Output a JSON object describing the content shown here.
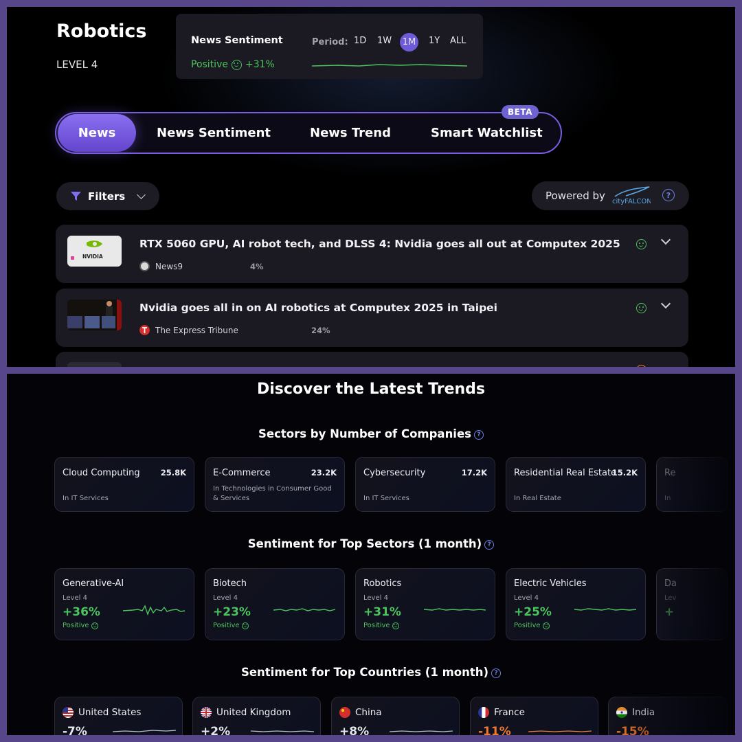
{
  "header": {
    "title": "Robotics",
    "level": "LEVEL 4"
  },
  "sentiment_card": {
    "title": "News Sentiment",
    "status": "Positive",
    "change": "+31%",
    "period_label": "Period:",
    "periods": [
      "1D",
      "1W",
      "1M",
      "1Y",
      "ALL"
    ],
    "active_period": "1M"
  },
  "tabs": [
    "News",
    "News Sentiment",
    "News Trend",
    "Smart Watchlist"
  ],
  "beta_badge": "BETA",
  "filters": {
    "label": "Filters"
  },
  "powered": {
    "label": "Powered by",
    "logo_text": "cityFALCON",
    "help": "?"
  },
  "news": [
    {
      "title": "RTX 5060 GPU, AI robot tech, and DLSS 4: Nvidia goes all out at Computex 2025",
      "source": "News9",
      "percent": "4%",
      "thumb_text": "NVIDIA"
    },
    {
      "title": "Nvidia goes all in on AI robotics at Computex 2025 in Taipei",
      "source": "The Express Tribune",
      "percent": "24%"
    }
  ],
  "bottom": {
    "title": "Discover the Latest Trends",
    "sectors_heading": "Sectors by Number of Companies",
    "sentiment_heading": "Sentiment for Top Sectors (1 month)",
    "countries_heading": "Sentiment for Top Countries (1 month)",
    "help": "?"
  },
  "sectors_by_companies": [
    {
      "name": "Cloud Computing",
      "count": "25.8K",
      "sub": "In IT Services"
    },
    {
      "name": "E-Commerce",
      "count": "23.2K",
      "sub": "In Technologies in Consumer Good & Services"
    },
    {
      "name": "Cybersecurity",
      "count": "17.2K",
      "sub": "In IT Services"
    },
    {
      "name": "Residential Real Estate",
      "count": "15.2K",
      "sub": "In Real Estate"
    },
    {
      "name": "Re",
      "count": "",
      "sub": "In"
    }
  ],
  "sector_sentiment": [
    {
      "name": "Generative-AI",
      "level": "Level 4",
      "value": "+36%",
      "status": "Positive"
    },
    {
      "name": "Biotech",
      "level": "Level 4",
      "value": "+23%",
      "status": "Positive"
    },
    {
      "name": "Robotics",
      "level": "Level 4",
      "value": "+31%",
      "status": "Positive"
    },
    {
      "name": "Electric Vehicles",
      "level": "Level 4",
      "value": "+25%",
      "status": "Positive"
    },
    {
      "name": "Da",
      "level": "Lev",
      "value": "+",
      "status": ""
    }
  ],
  "countries": [
    {
      "name": "United States",
      "value": "-7%",
      "flag": "us-flag-icon",
      "color": "#e6e6ee"
    },
    {
      "name": "United Kingdom",
      "value": "+2%",
      "flag": "uk-flag-icon",
      "color": "#e6e6ee"
    },
    {
      "name": "China",
      "value": "+8%",
      "flag": "china-flag-icon",
      "color": "#e6e6ee"
    },
    {
      "name": "France",
      "value": "-11%",
      "flag": "france-flag-icon",
      "color": "#f07a30"
    },
    {
      "name": "India",
      "value": "-15%",
      "flag": "india-flag-icon",
      "color": "#f07a30"
    }
  ],
  "colors": {
    "positive": "#4cc45e",
    "accent": "#6d5bd8",
    "negative": "#f07a30"
  }
}
